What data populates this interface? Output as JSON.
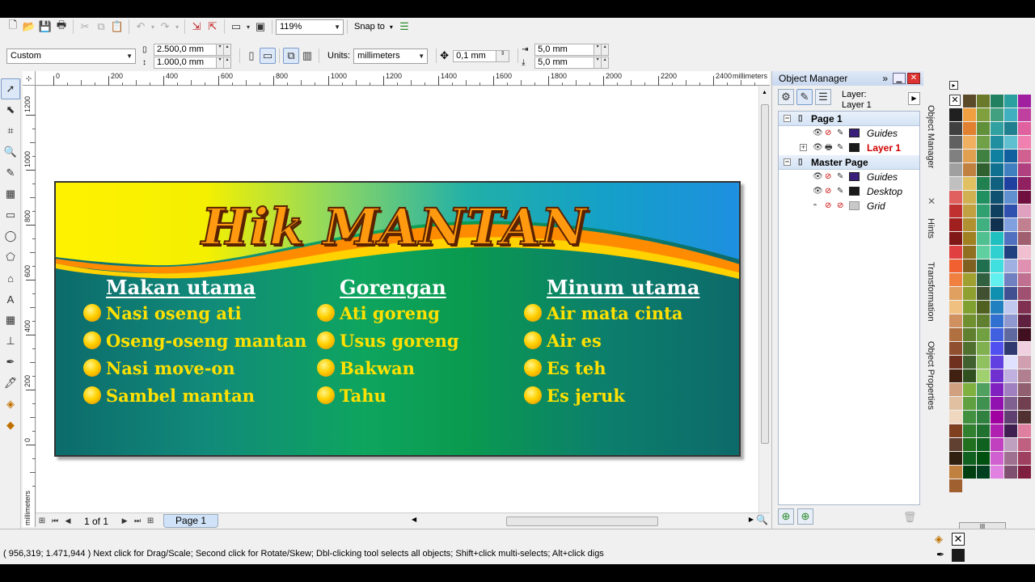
{
  "toolbar": {
    "zoom": "119%",
    "snap_to": "Snap to"
  },
  "propbar": {
    "preset": "Custom",
    "width": "2.500,0 mm",
    "height": "1.000,0 mm",
    "units_label": "Units:",
    "units": "millimeters",
    "nudge": "0,1 mm",
    "dup_x": "5,0 mm",
    "dup_y": "5,0 mm"
  },
  "ruler": {
    "h_ticks": [
      "0",
      "200",
      "400",
      "600",
      "800",
      "1000",
      "1200",
      "1400",
      "1600",
      "1800",
      "2000",
      "2200",
      "2400"
    ],
    "h_unit": "millimeters",
    "v_ticks": [
      "1200",
      "1000",
      "800",
      "600",
      "400",
      "200",
      "0"
    ],
    "v_unit": "millimeters"
  },
  "banner": {
    "title": "Hik MANTAN",
    "columns": [
      {
        "heading": "Makan utama",
        "items": [
          "Nasi oseng ati",
          "Oseng-oseng mantan",
          "Nasi move-on",
          "Sambel mantan"
        ]
      },
      {
        "heading": "Gorengan",
        "items": [
          "Ati goreng",
          "Usus goreng",
          "Bakwan",
          "Tahu"
        ]
      },
      {
        "heading": "Minum utama",
        "items": [
          "Air mata cinta",
          "Air es",
          "Es teh",
          "Es jeruk"
        ]
      }
    ]
  },
  "pagenav": {
    "counter": "1 of 1",
    "tab": "Page 1"
  },
  "object_manager": {
    "title": "Object Manager",
    "layer_label": "Layer:",
    "layer_value": "Layer 1",
    "tree": {
      "page": "Page 1",
      "page_children": [
        {
          "label": "Guides",
          "color": "#3a1f7a"
        },
        {
          "label": "Layer 1",
          "color": "#1a1a1a",
          "active": true
        }
      ],
      "master": "Master Page",
      "master_children": [
        {
          "label": "Guides",
          "color": "#3a1f7a"
        },
        {
          "label": "Desktop",
          "color": "#1a1a1a"
        },
        {
          "label": "Grid",
          "color": "#c8c8c8"
        }
      ]
    }
  },
  "side_tabs": [
    "Object Manager",
    "Hints",
    "Transformation",
    "Object Properties"
  ],
  "status": {
    "text": "( 956,319; 1.471,944 ) Next click for Drag/Scale; Second click for Rotate/Skew; Dbl-clicking tool selects all objects; Shift+click multi-selects; Alt+click digs"
  },
  "colors": {
    "banner_title": "#ff9a10",
    "item_text": "#ffe000",
    "heading_text": "#ffffff",
    "active_layer": "#d00000"
  }
}
